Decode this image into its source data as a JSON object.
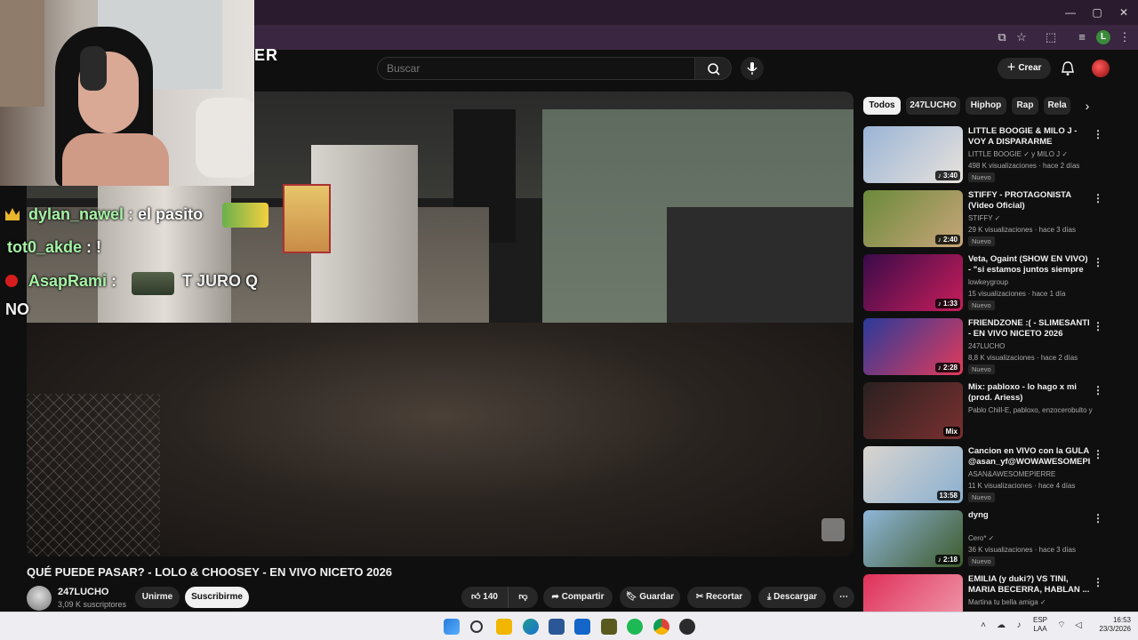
{
  "browser": {
    "window_controls": [
      "—",
      "▢",
      "✕"
    ],
    "toolbar_icons": [
      "cast-icon",
      "star-icon",
      "extensions-icon",
      "media-icon",
      "profile-icon",
      "menu-icon"
    ],
    "profile_initial": "L"
  },
  "header": {
    "logo_fragment": "ER",
    "search_placeholder": "Buscar",
    "create_label": "Crear"
  },
  "chat": {
    "lines": [
      {
        "user": "dylan_nawel",
        "sep": " : ",
        "msg": "el pasito"
      },
      {
        "user": "tot0_akde",
        "sep": " : ",
        "msg": "!"
      },
      {
        "user": "AsapRami",
        "sep": " : ",
        "msg": "T JURO Q"
      }
    ],
    "continuation": "NO"
  },
  "video": {
    "title": "QUÉ PUEDE PASAR? - LOLO & CHOOSEY - EN VIVO NICETO 2026",
    "channel": "247LUCHO",
    "subscribers": "3,09 K suscriptores",
    "join": "Unirme",
    "subscribe": "Suscribirme",
    "likes": "140",
    "share": "Compartir",
    "save": "Guardar",
    "clip": "Recortar",
    "download": "Descargar"
  },
  "chips": [
    "Todos",
    "247LUCHO",
    "Hiphop",
    "Rap",
    "Rela"
  ],
  "recommendations": [
    {
      "title": "LITTLE BOOGIE & MILO J - VOY A DISPARARME (VIDEOCLIP ...",
      "channel": "LITTLE BOOGIE ✓ y MILO J ✓",
      "meta": "498 K visualizaciones · hace 2 días",
      "badge": "Nuevo",
      "duration": "♪ 3:40",
      "colors": [
        "#9ab4d6",
        "#e8e2dc"
      ]
    },
    {
      "title": "STIFFY - PROTAGONISTA (Video Oficial)",
      "channel": "STIFFY ✓",
      "meta": "29 K visualizaciones · hace 3 días",
      "badge": "Nuevo",
      "duration": "♪ 2:40",
      "colors": [
        "#6a8a3a",
        "#c9a57a"
      ]
    },
    {
      "title": "Veta, Ogaint (SHOW EN VIVO) - \"si estamos juntos siempre ha...",
      "channel": "lowkeygroup",
      "meta": "15 visualizaciones · hace 1 día",
      "badge": "Nuevo",
      "duration": "♪ 1:33",
      "colors": [
        "#3a0a4a",
        "#c81e5a"
      ]
    },
    {
      "title": "FRIENDZONE :( - SLIMESANTI - EN VIVO NICETO 2026",
      "channel": "247LUCHO",
      "meta": "8,8 K visualizaciones · hace 2 días",
      "badge": "Nuevo",
      "duration": "♪ 2:28",
      "colors": [
        "#2a3a9a",
        "#e23a5a"
      ]
    },
    {
      "title": "Mix: pabloxo - lo hago x mi (prod. Ariess)",
      "channel": "Pablo Chill-E, pabloxo, enzocerobulto y ...",
      "meta": "",
      "badge": "",
      "duration": "Mix",
      "colors": [
        "#2a2020",
        "#7a3030"
      ]
    },
    {
      "title": "Cancion en VIVO con la GULA @asan_yf@WOWAWESOMEPI...",
      "channel": "ASAN&AWESOMEPIERRE",
      "meta": "11 K visualizaciones · hace 4 días",
      "badge": "Nuevo",
      "duration": "13:58",
      "colors": [
        "#d9d4cf",
        "#8ab0d0"
      ]
    },
    {
      "title": "dyng",
      "channel": "Cero* ✓",
      "meta": "36 K visualizaciones · hace 3 días",
      "badge": "Nuevo",
      "duration": "♪ 2:18",
      "colors": [
        "#8fb6d9",
        "#3d5a2a"
      ]
    },
    {
      "title": "EMILIA (y duki?) VS TINI, MARIA BECERRA, HABLAN ...",
      "channel": "Martina tu bella amiga ✓",
      "meta": "",
      "badge": "",
      "duration": "",
      "colors": [
        "#e0305a",
        "#f0a0b0"
      ]
    }
  ],
  "taskbar": {
    "lang": [
      "ESP",
      "LAA"
    ],
    "time": "16:53",
    "date": "23/3/2026",
    "apps": [
      "windows-start-icon",
      "search-icon",
      "file-explorer-icon",
      "edge-icon",
      "store-icon",
      "outlook-icon",
      "photos-icon",
      "spotify-icon",
      "chrome-icon",
      "obs-icon"
    ]
  }
}
